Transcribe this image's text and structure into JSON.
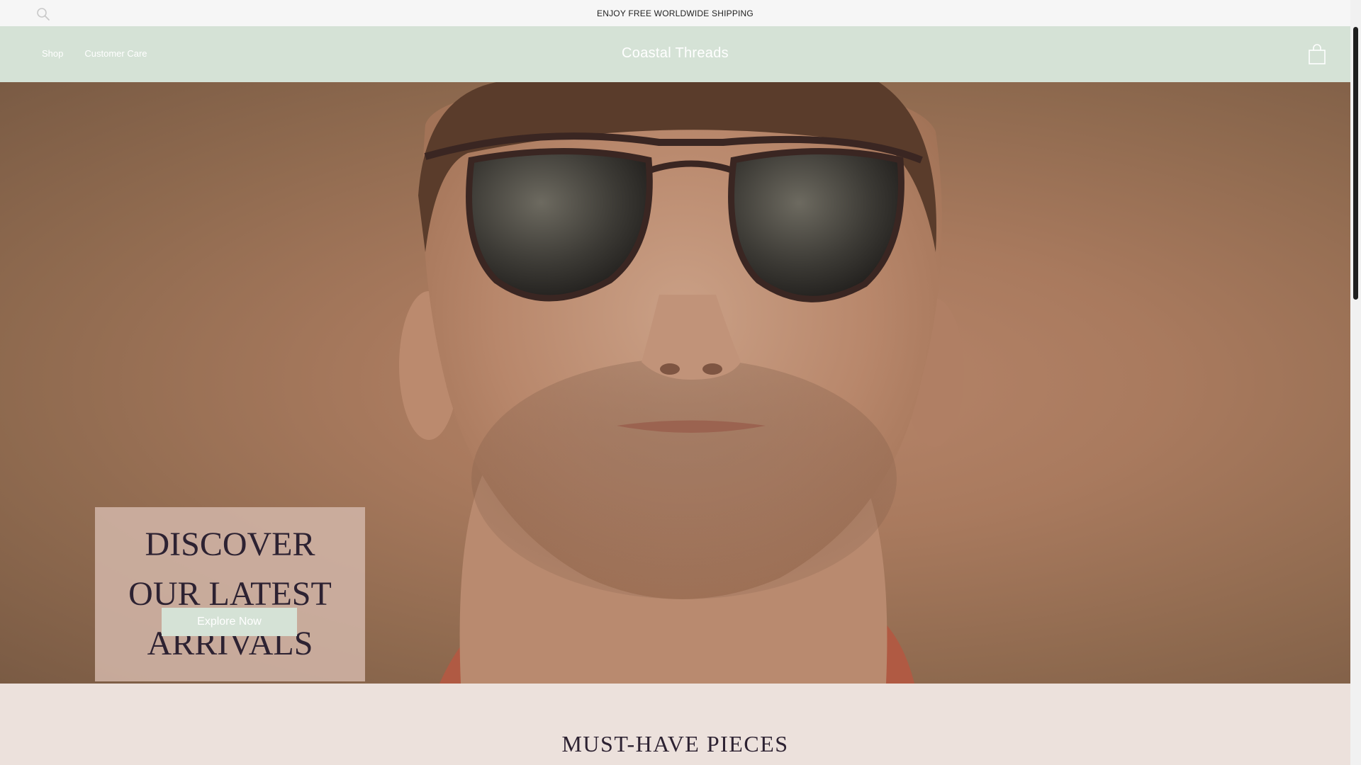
{
  "topbar": {
    "search_icon": "search-icon",
    "announcement": "ENJOY FREE WORLDWIDE SHIPPING"
  },
  "header": {
    "nav": [
      {
        "label": "Shop"
      },
      {
        "label": "Customer Care"
      }
    ],
    "brand": "Coastal Threads",
    "cart_icon": "shopping-bag-icon"
  },
  "hero": {
    "image": "man-with-sunglasses-photo",
    "title": "DISCOVER OUR LATEST ARRIVALS",
    "cta_label": "Explore Now"
  },
  "featured": {
    "title": "MUST-HAVE PIECES"
  },
  "colors": {
    "header_bg": "#d5e2d6",
    "topbar_bg": "#f6f6f6",
    "promo_box_bg": "#d0b4a6",
    "cta_bg": "#d5e2d6",
    "section_bg": "#ece1dc",
    "heading_text": "#2d2232"
  }
}
